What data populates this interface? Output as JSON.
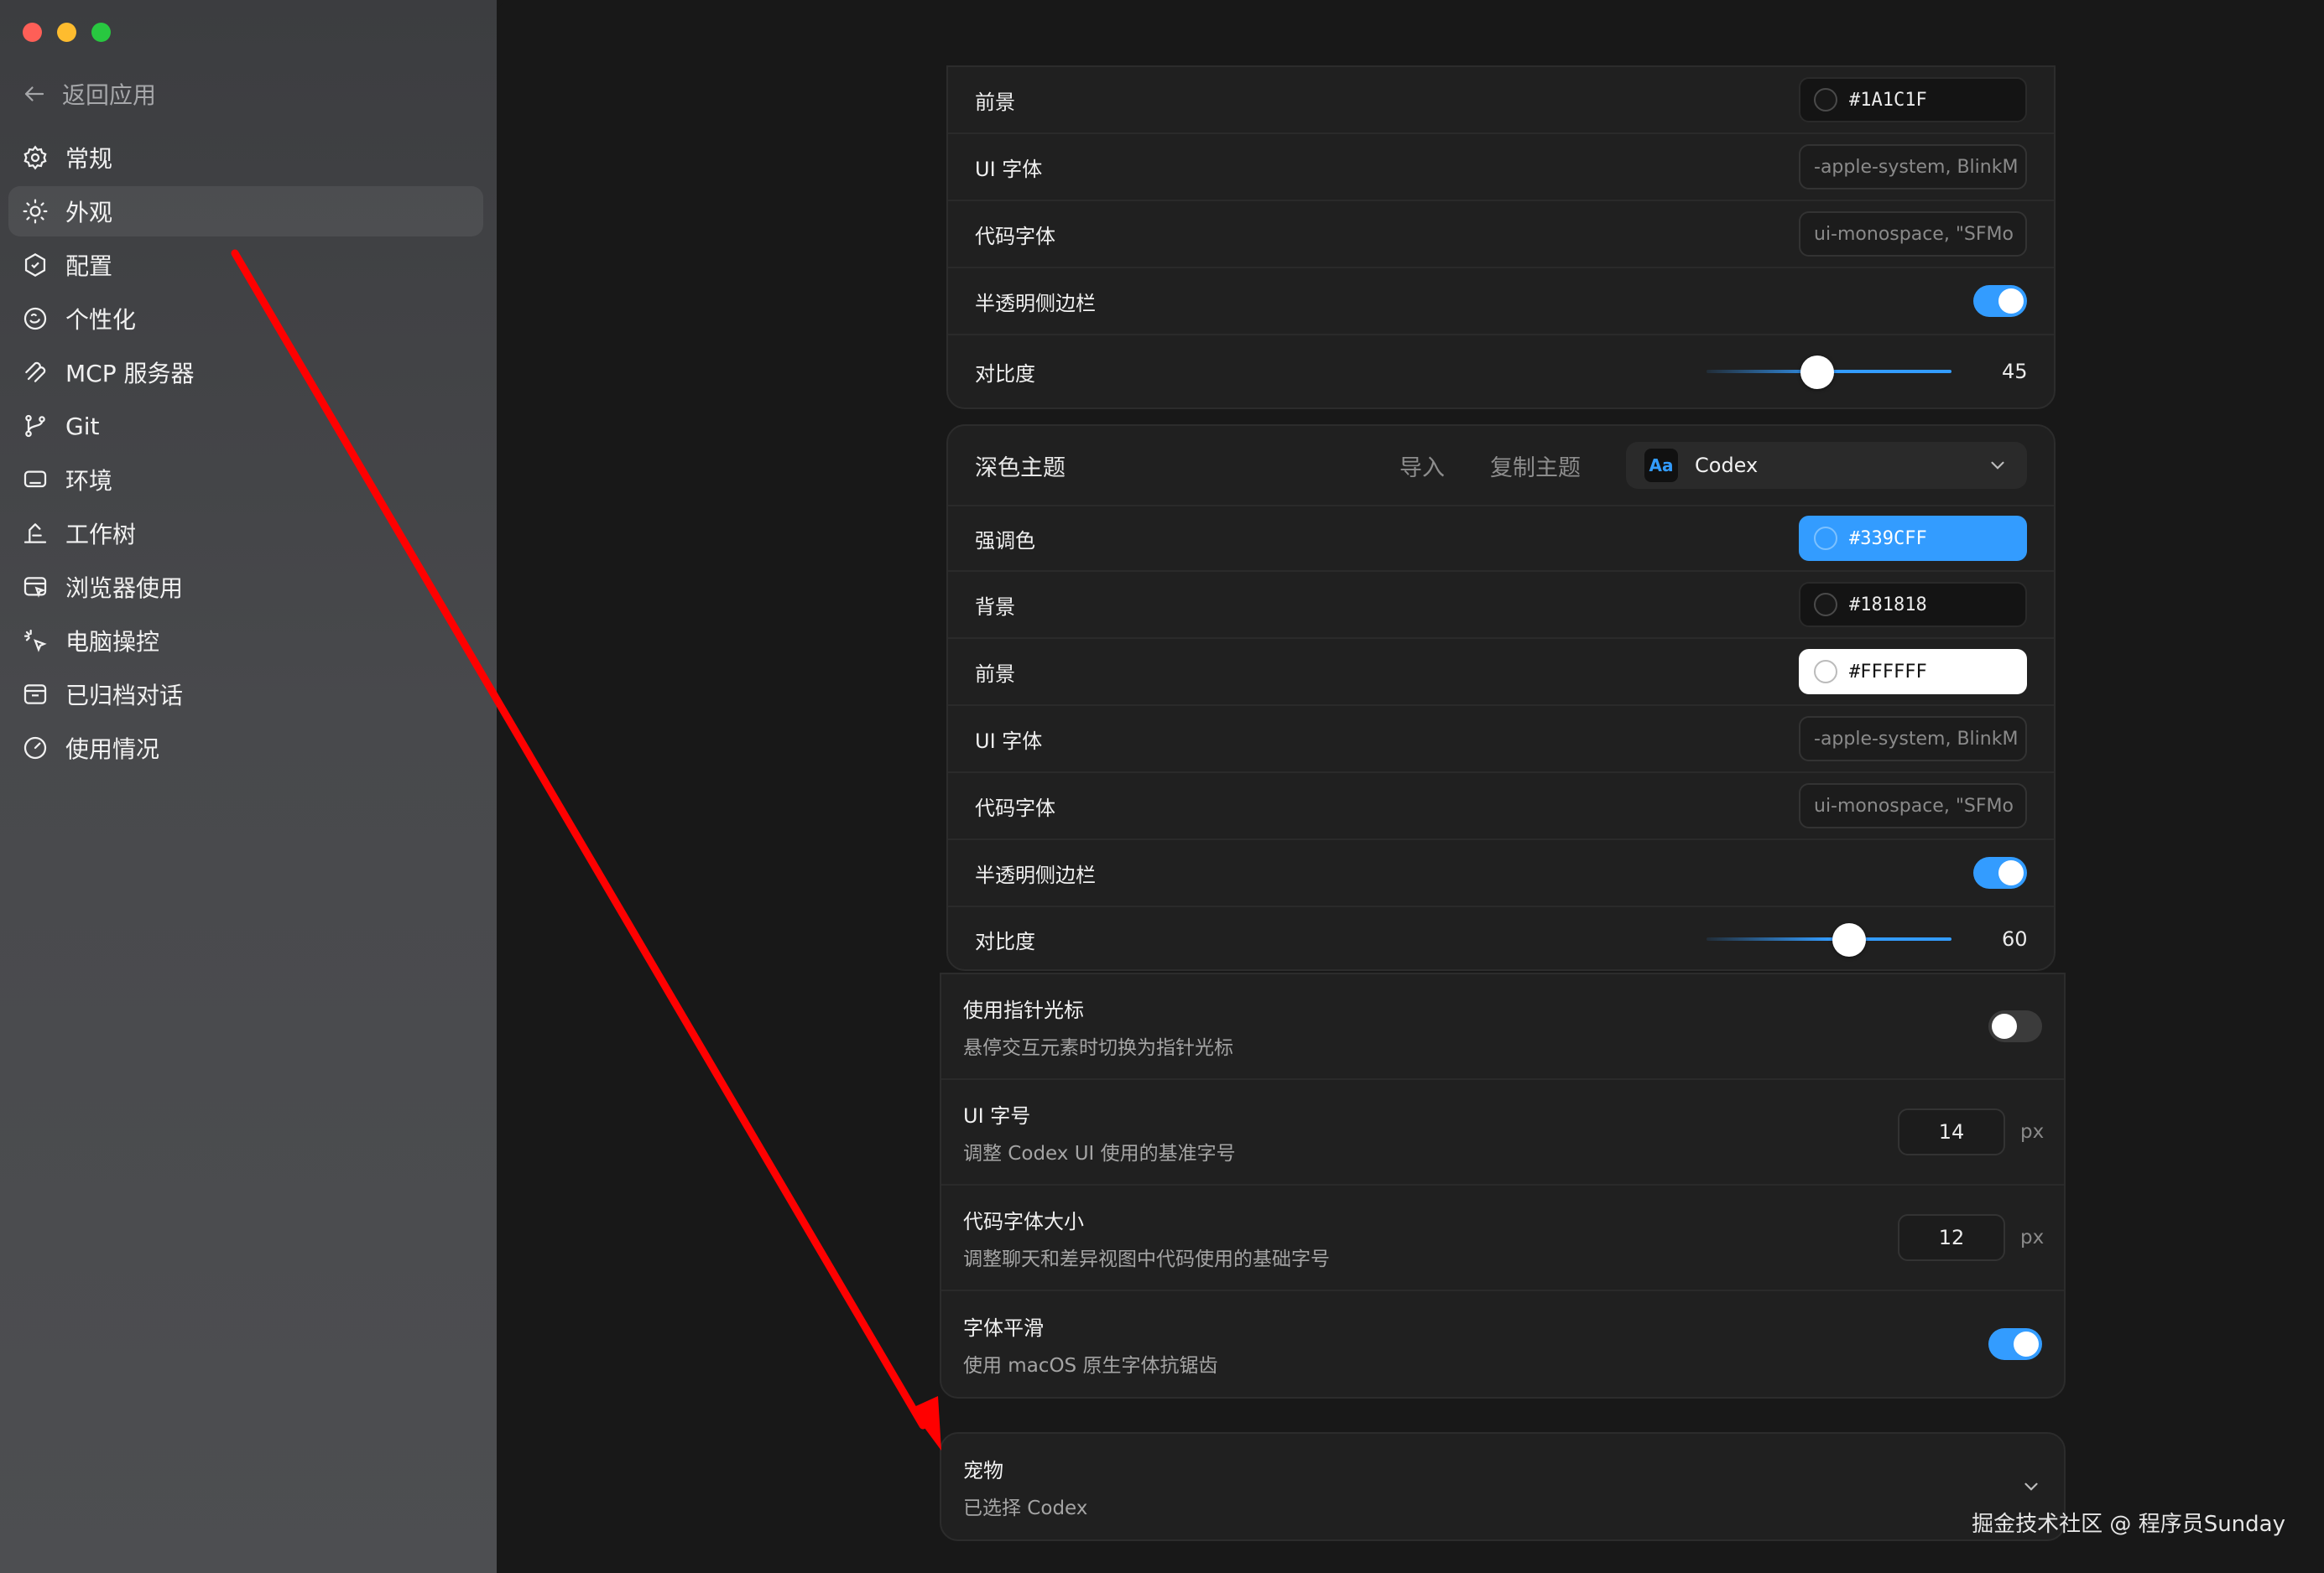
{
  "sidebar": {
    "back_label": "返回应用",
    "items": [
      {
        "label": "常规",
        "icon": "gear-icon"
      },
      {
        "label": "外观",
        "icon": "sun-icon",
        "active": true
      },
      {
        "label": "配置",
        "icon": "config-icon"
      },
      {
        "label": "个性化",
        "icon": "personalize-icon"
      },
      {
        "label": "MCP 服务器",
        "icon": "mcp-icon"
      },
      {
        "label": "Git",
        "icon": "git-branch-icon"
      },
      {
        "label": "环境",
        "icon": "monitor-icon"
      },
      {
        "label": "工作树",
        "icon": "worktree-icon"
      },
      {
        "label": "浏览器使用",
        "icon": "browser-icon"
      },
      {
        "label": "电脑操控",
        "icon": "cursor-click-icon"
      },
      {
        "label": "已归档对话",
        "icon": "archive-icon"
      },
      {
        "label": "使用情况",
        "icon": "gauge-icon"
      }
    ]
  },
  "light_theme": {
    "foreground_label": "前景",
    "foreground_value": "#1A1C1F",
    "ui_font_label": "UI 字体",
    "ui_font_value": "-apple-system, BlinkM",
    "code_font_label": "代码字体",
    "code_font_value": "ui-monospace, \"SFMo",
    "translucent_label": "半透明侧边栏",
    "translucent_on": true,
    "contrast_label": "对比度",
    "contrast_value": "45"
  },
  "dark_theme": {
    "title": "深色主题",
    "import_label": "导入",
    "copy_label": "复制主题",
    "selected_theme": "Codex",
    "selected_theme_icon_text": "Aa",
    "accent_label": "强调色",
    "accent_value": "#339CFF",
    "background_label": "背景",
    "background_value": "#181818",
    "foreground_label": "前景",
    "foreground_value": "#FFFFFF",
    "ui_font_label": "UI 字体",
    "ui_font_value": "-apple-system, BlinkM",
    "code_font_label": "代码字体",
    "code_font_value": "ui-monospace, \"SFMo",
    "translucent_label": "半透明侧边栏",
    "translucent_on": true,
    "contrast_label": "对比度",
    "contrast_value": "60"
  },
  "settings": {
    "pointer_title": "使用指针光标",
    "pointer_desc": "悬停交互元素时切换为指针光标",
    "pointer_on": false,
    "ui_size_title": "UI 字号",
    "ui_size_desc": "调整 Codex UI 使用的基准字号",
    "ui_size_value": "14",
    "ui_size_unit": "px",
    "code_size_title": "代码字体大小",
    "code_size_desc": "调整聊天和差异视图中代码使用的基础字号",
    "code_size_value": "12",
    "code_size_unit": "px",
    "smoothing_title": "字体平滑",
    "smoothing_desc": "使用 macOS 原生字体抗锯齿",
    "smoothing_on": true
  },
  "pet": {
    "title": "宠物",
    "subtitle": "已选择 Codex"
  },
  "watermark": "掘金技术社区 @ 程序员Sunday",
  "colors": {
    "accent": "#339CFF",
    "annotation_arrow": "#FF0000"
  }
}
